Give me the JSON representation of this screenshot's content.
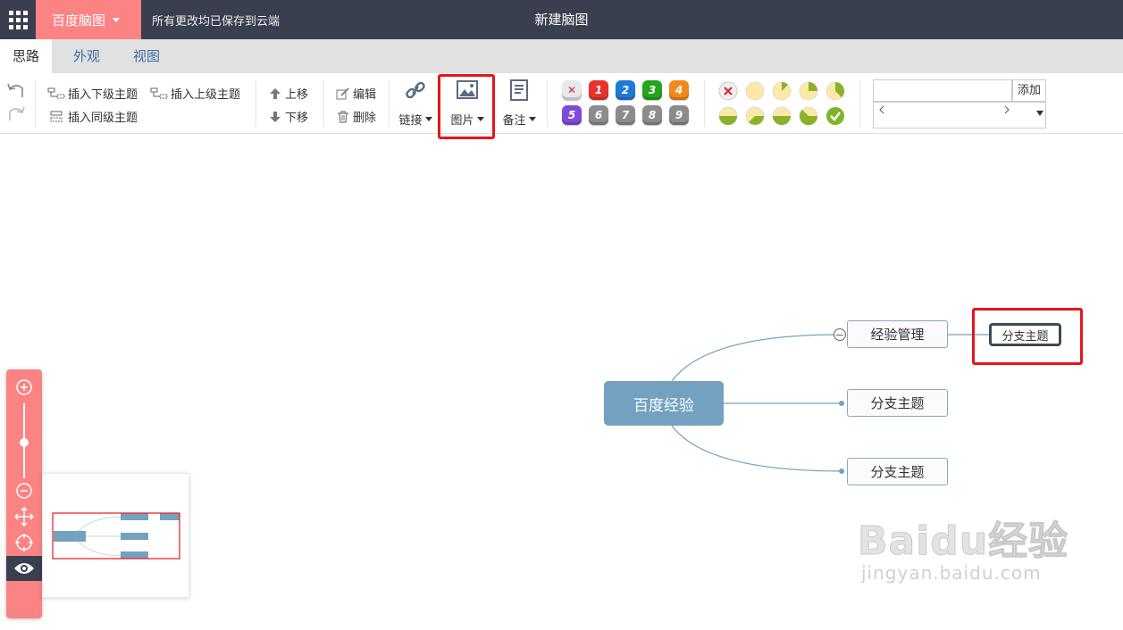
{
  "app": {
    "brand_label": "百度脑图",
    "save_status": "所有更改均已保存到云端",
    "doc_title": "新建脑图"
  },
  "tabs": [
    {
      "label": "思路",
      "active": true
    },
    {
      "label": "外观",
      "active": false
    },
    {
      "label": "视图",
      "active": false
    }
  ],
  "toolbar": {
    "insert_child": "插入下级主题",
    "insert_parent": "插入上级主题",
    "insert_sibling": "插入同级主题",
    "move_up": "上移",
    "move_down": "下移",
    "edit": "编辑",
    "delete": "删除",
    "link": "链接",
    "image": "图片",
    "note": "备注",
    "priorities": [
      "1",
      "2",
      "3",
      "4",
      "5",
      "6",
      "7",
      "8",
      "9"
    ],
    "priority_colors": [
      "#e9332a",
      "#1e7ad6",
      "#24a51b",
      "#f08a1c",
      "#7f4bd8",
      "#8c8c8c",
      "#8c8c8c",
      "#8c8c8c",
      "#8c8c8c"
    ],
    "resource_add": "添加"
  },
  "mindmap": {
    "root": "百度经验",
    "children": [
      {
        "label": "经验管理",
        "children": [
          {
            "label": "分支主题"
          }
        ]
      },
      {
        "label": "分支主题"
      },
      {
        "label": "分支主题"
      }
    ]
  },
  "watermark": {
    "brand": "Baidu经验",
    "url": "jingyan.baidu.com"
  },
  "colors": {
    "topbar": "#393f4f",
    "accent": "#fc8383",
    "node_border": "#86a8c5",
    "root_fill": "#73a1bf",
    "highlight": "#e8141b"
  }
}
